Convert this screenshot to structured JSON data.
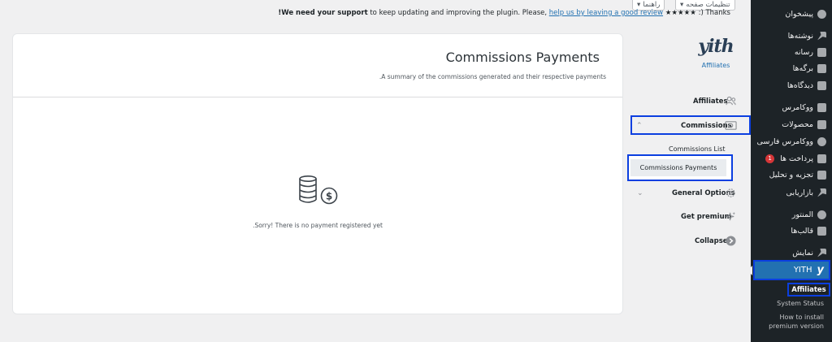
{
  "top_bar": {
    "screen_options": "تنظیمات صفحه",
    "help": "راهنما",
    "notice": {
      "bold": "!We need your support",
      "text": " to keep updating and improving the plugin. Please, ",
      "link": "help us by leaving a good review",
      "tail": " ★★★★★ :) Thanks"
    }
  },
  "wp_sidebar": {
    "items": [
      {
        "label": "پیشخوان",
        "icon": "dashboard-icon"
      },
      {
        "label": "نوشته‌ها",
        "icon": "pin-icon"
      },
      {
        "label": "رسانه",
        "icon": "media-icon"
      },
      {
        "label": "برگه‌ها",
        "icon": "pages-icon"
      },
      {
        "label": "دیدگاه‌ها",
        "icon": "comments-icon"
      },
      {
        "label": "ووکامرس",
        "icon": "woocommerce-icon"
      },
      {
        "label": "محصولات",
        "icon": "products-icon"
      },
      {
        "label": "ووکامرس فارسی",
        "icon": "woo-persian-icon"
      },
      {
        "label": "پرداخت ها",
        "icon": "payments-icon",
        "badge": "1"
      },
      {
        "label": "تجزیه و تحلیل",
        "icon": "analytics-icon"
      },
      {
        "label": "بازاریابی",
        "icon": "marketing-icon"
      },
      {
        "label": "المنتور",
        "icon": "elementor-icon"
      },
      {
        "label": "قالب‌ها",
        "icon": "templates-icon"
      },
      {
        "label": "نمایش",
        "icon": "appearance-icon"
      }
    ],
    "yith": {
      "label": "YITH",
      "glyph": "y"
    },
    "submenu": {
      "affiliates": "Affiliates",
      "system_status": "System Status",
      "install_premium": "How to install premium version"
    }
  },
  "plugin_nav": {
    "logo_text": "yith",
    "logo_label": "Affiliates",
    "items": {
      "affiliates": "Affiliates",
      "commissions": "Commissions",
      "commissions_list": "Commissions List",
      "commissions_payments": "Commissions Payments",
      "general_options": "General Options",
      "get_premium": "Get premium",
      "collapse": "Collapse"
    }
  },
  "main": {
    "title": "Commissions Payments",
    "subtitle": ".A summary of the commissions generated and their respective payments",
    "empty_message": ".Sorry! There is no payment registered yet"
  }
}
